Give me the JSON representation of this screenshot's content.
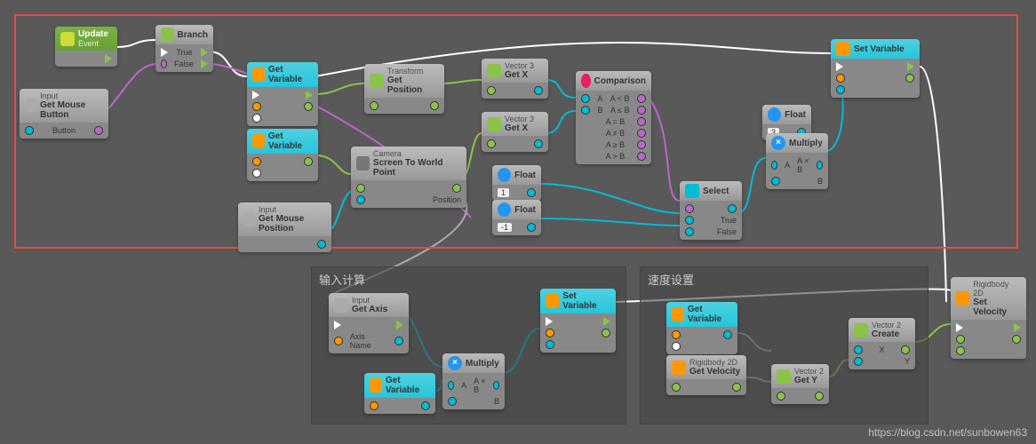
{
  "watermark": "https://blog.csdn.net/sunbowen63",
  "groups": {
    "input_calc": "输入计算",
    "velocity": "速度设置"
  },
  "nodes": {
    "update": {
      "title": "Update",
      "sub": "Event"
    },
    "branch": {
      "title": "Branch",
      "true": "True",
      "false": "False"
    },
    "getMouseBtn": {
      "title": "Input",
      "sub": "Get Mouse Button",
      "p1": "Button"
    },
    "getVar1": {
      "title": "Get Variable"
    },
    "getVar2": {
      "title": "Get Variable"
    },
    "getMousePos": {
      "title": "Input",
      "sub": "Get Mouse Position"
    },
    "getPosition": {
      "title": "Transform",
      "sub": "Get Position"
    },
    "screenToWorld": {
      "title": "Camera",
      "sub": "Screen To World Point",
      "p1": "Position"
    },
    "getX1": {
      "title": "Vector 3",
      "sub": "Get X"
    },
    "getX2": {
      "title": "Vector 3",
      "sub": "Get X"
    },
    "comparison": {
      "title": "Comparison",
      "a": "A",
      "b": "B",
      "lt": "A < B",
      "le": "A ≤ B",
      "eq": "A = B",
      "ne": "A ≠ B",
      "ge": "A ≥ B",
      "gt": "A > B"
    },
    "float1": {
      "title": "Float",
      "val": "1"
    },
    "floatNeg1": {
      "title": "Float",
      "val": "-1"
    },
    "float3": {
      "title": "Float",
      "val": "3"
    },
    "select": {
      "title": "Select",
      "true": "True",
      "false": "False"
    },
    "multiply1": {
      "title": "Multiply",
      "a": "A",
      "b": "B",
      "out": "A × B"
    },
    "setVar1": {
      "title": "Set Variable"
    },
    "getAxis": {
      "title": "Input",
      "sub": "Get Axis",
      "p1": "Axis Name"
    },
    "getVar3": {
      "title": "Get Variable"
    },
    "multiply2": {
      "title": "Multiply",
      "a": "A",
      "b": "B",
      "out": "A × B"
    },
    "setVar2": {
      "title": "Set Variable"
    },
    "getVar4": {
      "title": "Get Variable"
    },
    "rigidGetVel": {
      "title": "Rigidbody 2D",
      "sub": "Get Velocity"
    },
    "getY": {
      "title": "Vector 2",
      "sub": "Get Y"
    },
    "vecCreate": {
      "title": "Vector 2",
      "sub": "Create",
      "x": "X",
      "y": "Y"
    },
    "rigidSetVel": {
      "title": "Rigidbody 2D",
      "sub": "Set Velocity"
    }
  }
}
